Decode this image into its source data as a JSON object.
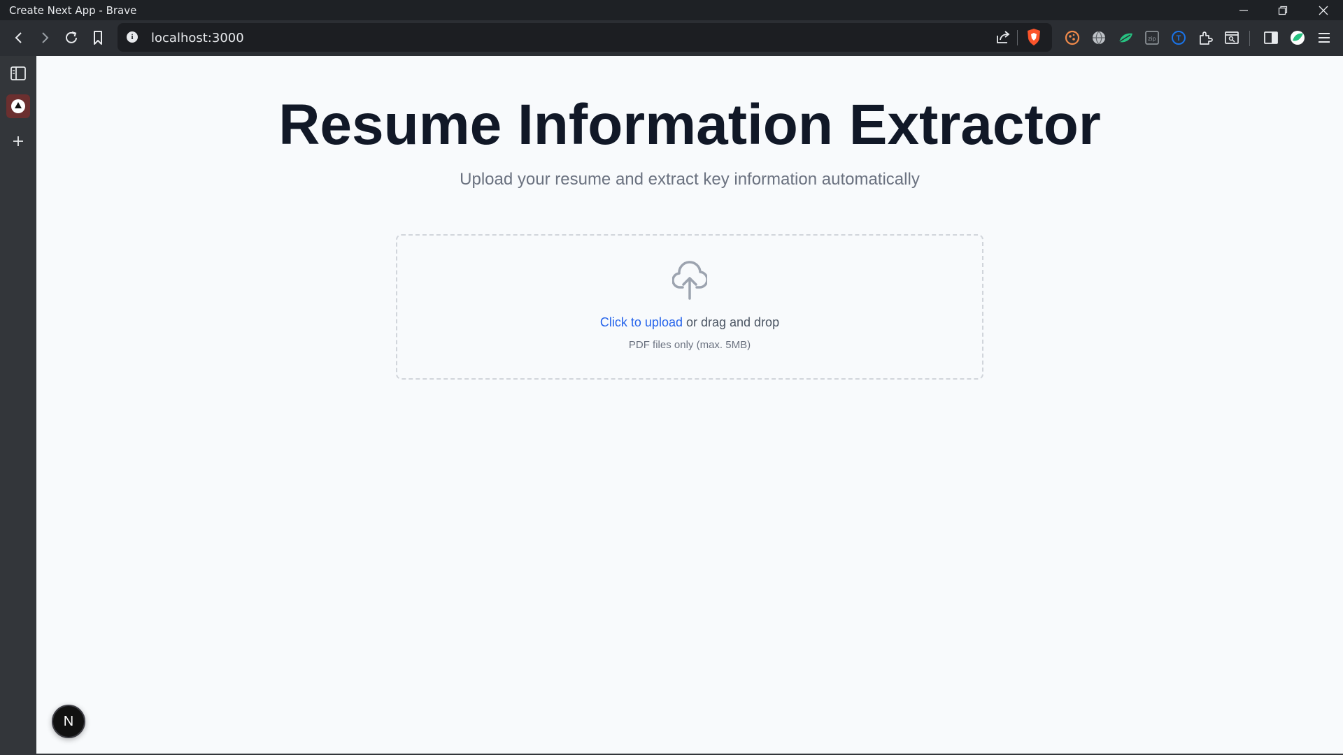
{
  "window": {
    "title": "Create Next App - Brave"
  },
  "toolbar": {
    "url": "localhost:3000"
  },
  "page": {
    "title": "Resume Information Extractor",
    "subtitle": "Upload your resume and extract key information automatically",
    "upload": {
      "link_text": "Click to upload",
      "rest_text": " or drag and drop",
      "hint": "PDF files only (max. 5MB)"
    }
  },
  "dev": {
    "badge_letter": "N"
  },
  "colors": {
    "accent": "#2563eb",
    "heading": "#111827",
    "muted": "#6b7280",
    "page_bg": "#f8fafc"
  },
  "icons": [
    "back-icon",
    "forward-icon",
    "reload-icon",
    "bookmark-icon",
    "info-icon",
    "share-icon",
    "brave-shield-icon",
    "extension-icon",
    "sidebar-icon",
    "menu-icon",
    "upload-cloud-icon"
  ]
}
